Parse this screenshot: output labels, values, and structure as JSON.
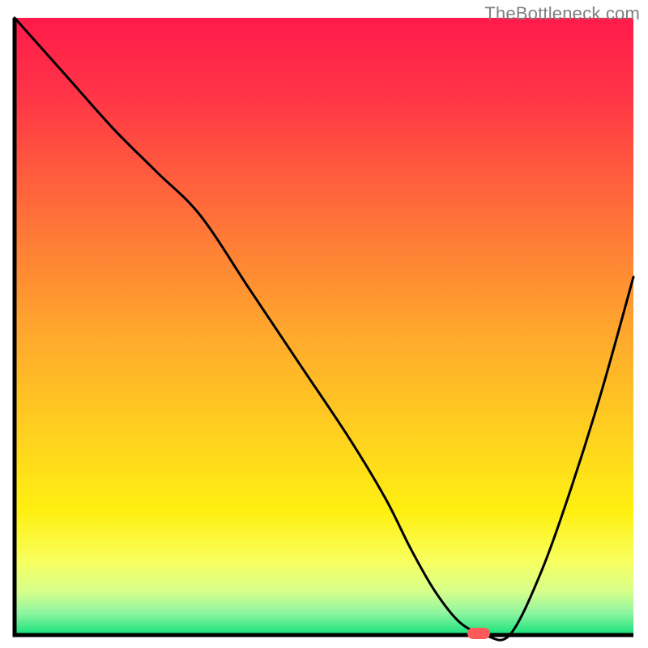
{
  "watermark": "TheBottleneck.com",
  "chart_data": {
    "type": "line",
    "title": "",
    "xlabel": "",
    "ylabel": "",
    "xlim": [
      0,
      100
    ],
    "ylim": [
      0,
      100
    ],
    "gradient_stops": [
      {
        "offset": 0.0,
        "color": "#ff1a4a"
      },
      {
        "offset": 0.12,
        "color": "#ff3347"
      },
      {
        "offset": 0.3,
        "color": "#ff6a3a"
      },
      {
        "offset": 0.5,
        "color": "#ffa52e"
      },
      {
        "offset": 0.68,
        "color": "#ffd21f"
      },
      {
        "offset": 0.8,
        "color": "#fff011"
      },
      {
        "offset": 0.88,
        "color": "#f8ff5e"
      },
      {
        "offset": 0.93,
        "color": "#d6ff8c"
      },
      {
        "offset": 0.965,
        "color": "#8cf5a0"
      },
      {
        "offset": 1.0,
        "color": "#14e07a"
      }
    ],
    "series": [
      {
        "name": "bottleneck-curve",
        "x": [
          0,
          8,
          16,
          23,
          30,
          38,
          46,
          54,
          60,
          64,
          68,
          72,
          76,
          80,
          85,
          90,
          95,
          100
        ],
        "y": [
          100,
          91,
          82,
          75,
          68,
          56,
          44,
          32,
          22,
          14,
          7,
          2,
          0,
          0,
          10,
          24,
          40,
          58
        ]
      }
    ],
    "marker": {
      "x": 75,
      "y": 0,
      "color": "#ff5a5a"
    },
    "axis_color": "#000000"
  }
}
